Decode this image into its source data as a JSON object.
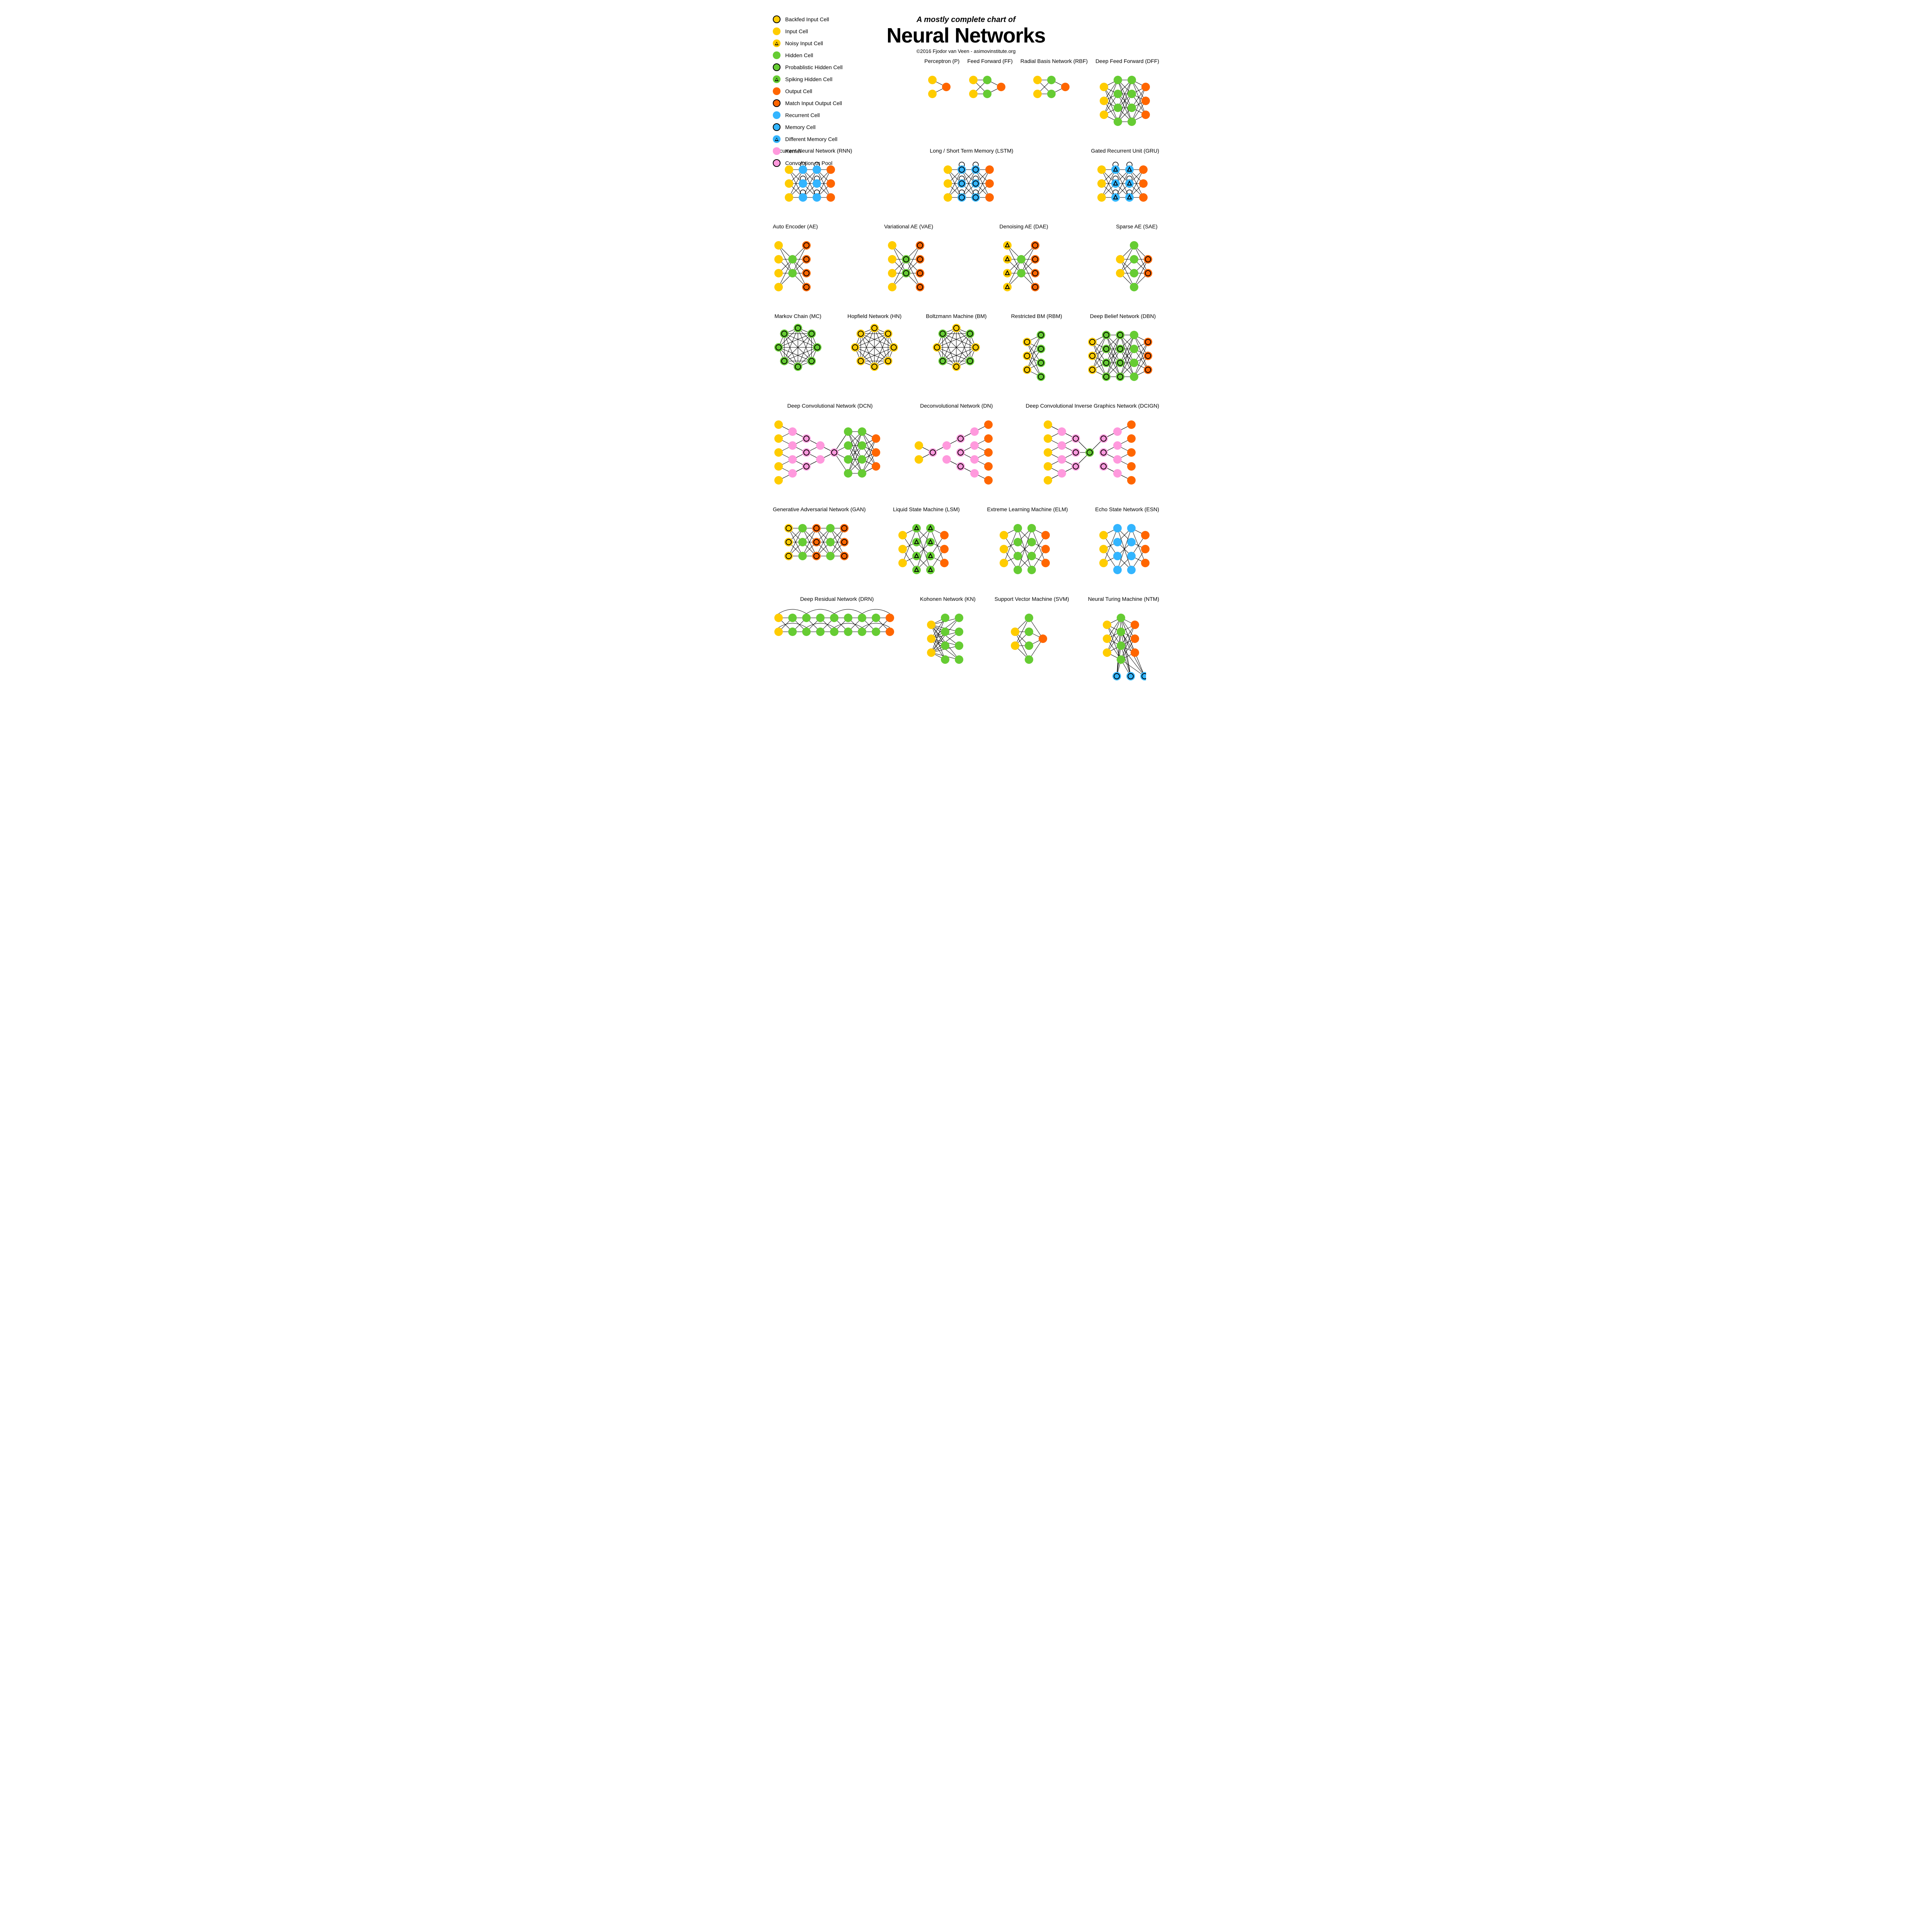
{
  "title": {
    "super": "A mostly complete chart of",
    "main": "Neural Networks",
    "copyright": "©2016 Fjodor van Veen - asimovinstitute.org"
  },
  "legend": [
    {
      "label": "Backfed Input Cell",
      "color": "#ffcc00",
      "ring": true
    },
    {
      "label": "Input Cell",
      "color": "#ffcc00"
    },
    {
      "label": "Noisy Input Cell",
      "color": "#ffcc00",
      "tri": true
    },
    {
      "label": "Hidden Cell",
      "color": "#66cc33"
    },
    {
      "label": "Probablistic Hidden Cell",
      "color": "#66cc33",
      "ring": true
    },
    {
      "label": "Spiking Hidden Cell",
      "color": "#66cc33",
      "tri": true
    },
    {
      "label": "Output Cell",
      "color": "#ff6600"
    },
    {
      "label": "Match Input Output Cell",
      "color": "#ff6600",
      "ring": true
    },
    {
      "label": "Recurrent Cell",
      "color": "#33b5ff"
    },
    {
      "label": "Memory Cell",
      "color": "#33b5ff",
      "ring": true
    },
    {
      "label": "Different Memory Cell",
      "color": "#33b5ff",
      "tri": true
    },
    {
      "label": "Kernel",
      "color": "#ff99dd"
    },
    {
      "label": "Convolution or Pool",
      "color": "#ff99dd",
      "ring": true
    }
  ],
  "chart_data": {
    "type": "diagram",
    "node_types": {
      "input": {
        "color": "yellow"
      },
      "input_backfed": {
        "color": "yellow",
        "ring": true
      },
      "input_noisy": {
        "color": "yellow",
        "tri": true
      },
      "hidden": {
        "color": "green"
      },
      "hidden_prob": {
        "color": "green",
        "ring": true
      },
      "hidden_spike": {
        "color": "green",
        "tri": true
      },
      "output": {
        "color": "orange"
      },
      "output_match": {
        "color": "orange",
        "ring": true
      },
      "recurrent": {
        "color": "blue"
      },
      "memory": {
        "color": "blue",
        "ring": true
      },
      "memory_diff": {
        "color": "blue",
        "tri": true
      },
      "kernel": {
        "color": "pink"
      },
      "conv": {
        "color": "pink",
        "ring": true
      }
    },
    "networks": [
      {
        "id": "p",
        "title": "Perceptron (P)",
        "layers": [
          [
            "input",
            "input"
          ],
          [
            "output"
          ]
        ],
        "conn": "full"
      },
      {
        "id": "ff",
        "title": "Feed Forward (FF)",
        "layers": [
          [
            "input",
            "input"
          ],
          [
            "hidden",
            "hidden"
          ],
          [
            "output"
          ]
        ],
        "conn": "full"
      },
      {
        "id": "rbf",
        "title": "Radial Basis Network (RBF)",
        "layers": [
          [
            "input",
            "input"
          ],
          [
            "hidden",
            "hidden"
          ],
          [
            "output"
          ]
        ],
        "conn": "full"
      },
      {
        "id": "dff",
        "title": "Deep Feed Forward (DFF)",
        "layers": [
          [
            "input",
            "input",
            "input"
          ],
          [
            "hidden",
            "hidden",
            "hidden",
            "hidden"
          ],
          [
            "hidden",
            "hidden",
            "hidden",
            "hidden"
          ],
          [
            "output",
            "output",
            "output"
          ]
        ],
        "conn": "full"
      },
      {
        "id": "rnn",
        "title": "Recurrent Neural Network (RNN)",
        "layers": [
          [
            "input",
            "input",
            "input"
          ],
          [
            "recurrent",
            "recurrent",
            "recurrent"
          ],
          [
            "recurrent",
            "recurrent",
            "recurrent"
          ],
          [
            "output",
            "output",
            "output"
          ]
        ],
        "conn": "full",
        "loops": [
          1,
          2
        ]
      },
      {
        "id": "lstm",
        "title": "Long / Short Term Memory (LSTM)",
        "layers": [
          [
            "input",
            "input",
            "input"
          ],
          [
            "memory",
            "memory",
            "memory"
          ],
          [
            "memory",
            "memory",
            "memory"
          ],
          [
            "output",
            "output",
            "output"
          ]
        ],
        "conn": "full",
        "loops": [
          1,
          2
        ]
      },
      {
        "id": "gru",
        "title": "Gated Recurrent Unit (GRU)",
        "layers": [
          [
            "input",
            "input",
            "input"
          ],
          [
            "memory_diff",
            "memory_diff",
            "memory_diff"
          ],
          [
            "memory_diff",
            "memory_diff",
            "memory_diff"
          ],
          [
            "output",
            "output",
            "output"
          ]
        ],
        "conn": "full",
        "loops": [
          1,
          2
        ]
      },
      {
        "id": "ae",
        "title": "Auto Encoder (AE)",
        "layers": [
          [
            "input",
            "input",
            "input",
            "input"
          ],
          [
            "hidden",
            "hidden"
          ],
          [
            "output_match",
            "output_match",
            "output_match",
            "output_match"
          ]
        ],
        "conn": "full"
      },
      {
        "id": "vae",
        "title": "Variational AE (VAE)",
        "layers": [
          [
            "input",
            "input",
            "input",
            "input"
          ],
          [
            "hidden_prob",
            "hidden_prob"
          ],
          [
            "output_match",
            "output_match",
            "output_match",
            "output_match"
          ]
        ],
        "conn": "full"
      },
      {
        "id": "dae",
        "title": "Denoising AE (DAE)",
        "layers": [
          [
            "input_noisy",
            "input_noisy",
            "input_noisy",
            "input_noisy"
          ],
          [
            "hidden",
            "hidden"
          ],
          [
            "output_match",
            "output_match",
            "output_match",
            "output_match"
          ]
        ],
        "conn": "full"
      },
      {
        "id": "sae",
        "title": "Sparse AE (SAE)",
        "layers": [
          [
            "input",
            "input"
          ],
          [
            "hidden",
            "hidden",
            "hidden",
            "hidden"
          ],
          [
            "output_match",
            "output_match"
          ]
        ],
        "conn": "full"
      },
      {
        "id": "mc",
        "title": "Markov Chain (MC)",
        "shape": "ring",
        "count": 8,
        "type": "hidden_prob"
      },
      {
        "id": "hn",
        "title": "Hopfield Network (HN)",
        "shape": "ring",
        "count": 8,
        "type": "input_backfed"
      },
      {
        "id": "bm",
        "title": "Boltzmann Machine (BM)",
        "shape": "ring",
        "count": 8,
        "alt": [
          "input_backfed",
          "hidden_prob"
        ]
      },
      {
        "id": "rbm",
        "title": "Restricted BM (RBM)",
        "layers": [
          [
            "input_backfed",
            "input_backfed",
            "input_backfed"
          ],
          [
            "hidden_prob",
            "hidden_prob",
            "hidden_prob",
            "hidden_prob"
          ]
        ],
        "conn": "full"
      },
      {
        "id": "dbn",
        "title": "Deep Belief Network (DBN)",
        "layers": [
          [
            "input_backfed",
            "input_backfed",
            "input_backfed"
          ],
          [
            "hidden_prob",
            "hidden_prob",
            "hidden_prob",
            "hidden_prob"
          ],
          [
            "hidden_prob",
            "hidden_prob",
            "hidden_prob",
            "hidden_prob"
          ],
          [
            "hidden",
            "hidden",
            "hidden",
            "hidden"
          ],
          [
            "output_match",
            "output_match",
            "output_match"
          ]
        ],
        "conn": "full"
      },
      {
        "id": "dcn",
        "title": "Deep Convolutional Network (DCN)",
        "layers": [
          [
            "input",
            "input",
            "input",
            "input",
            "input"
          ],
          [
            "kernel",
            "kernel",
            "kernel",
            "kernel"
          ],
          [
            "conv",
            "conv",
            "conv"
          ],
          [
            "kernel",
            "kernel"
          ],
          [
            "conv"
          ],
          [
            "hidden",
            "hidden",
            "hidden",
            "hidden"
          ],
          [
            "hidden",
            "hidden",
            "hidden",
            "hidden"
          ],
          [
            "output",
            "output",
            "output"
          ]
        ],
        "conn": "conv_dense"
      },
      {
        "id": "dn",
        "title": "Deconvolutional Network (DN)",
        "layers": [
          [
            "input",
            "input"
          ],
          [
            "conv"
          ],
          [
            "kernel",
            "kernel"
          ],
          [
            "conv",
            "conv",
            "conv"
          ],
          [
            "kernel",
            "kernel",
            "kernel",
            "kernel"
          ],
          [
            "output",
            "output",
            "output",
            "output",
            "output"
          ]
        ],
        "conn": "conv"
      },
      {
        "id": "dcign",
        "title": "Deep Convolutional Inverse Graphics Network (DCIGN)",
        "layers": [
          [
            "input",
            "input",
            "input",
            "input",
            "input"
          ],
          [
            "kernel",
            "kernel",
            "kernel",
            "kernel"
          ],
          [
            "conv",
            "conv",
            "conv"
          ],
          [
            "hidden_prob"
          ],
          [
            "conv",
            "conv",
            "conv"
          ],
          [
            "kernel",
            "kernel",
            "kernel",
            "kernel"
          ],
          [
            "output",
            "output",
            "output",
            "output",
            "output"
          ]
        ],
        "conn": "conv"
      },
      {
        "id": "gan",
        "title": "Generative Adversarial Network (GAN)",
        "layers": [
          [
            "input_backfed",
            "input_backfed",
            "input_backfed"
          ],
          [
            "hidden",
            "hidden",
            "hidden"
          ],
          [
            "output_match",
            "output_match",
            "output_match"
          ],
          [
            "hidden",
            "hidden",
            "hidden"
          ],
          [
            "output_match",
            "output_match",
            "output_match"
          ]
        ],
        "conn": "full"
      },
      {
        "id": "lsm",
        "title": "Liquid State Machine (LSM)",
        "layers": [
          [
            "input",
            "input",
            "input"
          ],
          [
            "hidden_spike",
            "hidden_spike",
            "hidden_spike",
            "hidden_spike"
          ],
          [
            "hidden_spike",
            "hidden_spike",
            "hidden_spike",
            "hidden_spike"
          ],
          [
            "output",
            "output",
            "output"
          ]
        ],
        "conn": "sparse"
      },
      {
        "id": "elm",
        "title": "Extreme Learning Machine (ELM)",
        "layers": [
          [
            "input",
            "input",
            "input"
          ],
          [
            "hidden",
            "hidden",
            "hidden",
            "hidden"
          ],
          [
            "hidden",
            "hidden",
            "hidden",
            "hidden"
          ],
          [
            "output",
            "output",
            "output"
          ]
        ],
        "conn": "sparse"
      },
      {
        "id": "esn",
        "title": "Echo State Network (ESN)",
        "layers": [
          [
            "input",
            "input",
            "input"
          ],
          [
            "recurrent",
            "recurrent",
            "recurrent",
            "recurrent"
          ],
          [
            "recurrent",
            "recurrent",
            "recurrent",
            "recurrent"
          ],
          [
            "output",
            "output",
            "output"
          ]
        ],
        "conn": "sparse"
      },
      {
        "id": "drn",
        "title": "Deep Residual Network (DRN)",
        "layers": [
          [
            "input",
            "input"
          ],
          [
            "hidden",
            "hidden"
          ],
          [
            "hidden",
            "hidden"
          ],
          [
            "hidden",
            "hidden"
          ],
          [
            "hidden",
            "hidden"
          ],
          [
            "hidden",
            "hidden"
          ],
          [
            "hidden",
            "hidden"
          ],
          [
            "hidden",
            "hidden"
          ],
          [
            "output",
            "output"
          ]
        ],
        "conn": "full",
        "skips": true
      },
      {
        "id": "kn",
        "title": "Kohonen Network (KN)",
        "layers": [
          [
            "input",
            "input",
            "input"
          ],
          [
            "hidden",
            "hidden",
            "hidden",
            "hidden"
          ],
          [
            "hidden",
            "hidden",
            "hidden",
            "hidden"
          ]
        ],
        "conn": "full_first"
      },
      {
        "id": "svm",
        "title": "Support Vector Machine (SVM)",
        "layers": [
          [
            "input",
            "input"
          ],
          [
            "hidden",
            "hidden",
            "hidden",
            "hidden"
          ],
          [
            "output"
          ]
        ],
        "conn": "full"
      },
      {
        "id": "ntm",
        "title": "Neural Turing Machine (NTM)",
        "layers": [
          [
            "input",
            "input",
            "input"
          ],
          [
            "hidden",
            "hidden",
            "hidden",
            "hidden"
          ],
          [
            "output",
            "output",
            "output"
          ]
        ],
        "conn": "full",
        "extra_mem": 3
      }
    ]
  },
  "rows": [
    [
      "p",
      "ff",
      "rbf",
      "dff"
    ],
    [
      "rnn",
      "lstm",
      "gru"
    ],
    [
      "ae",
      "vae",
      "dae",
      "sae"
    ],
    [
      "mc",
      "hn",
      "bm",
      "rbm",
      "dbn"
    ],
    [
      "dcn",
      "dn",
      "dcign"
    ],
    [
      "gan",
      "lsm",
      "elm",
      "esn"
    ],
    [
      "drn",
      "kn",
      "svm",
      "ntm"
    ]
  ]
}
